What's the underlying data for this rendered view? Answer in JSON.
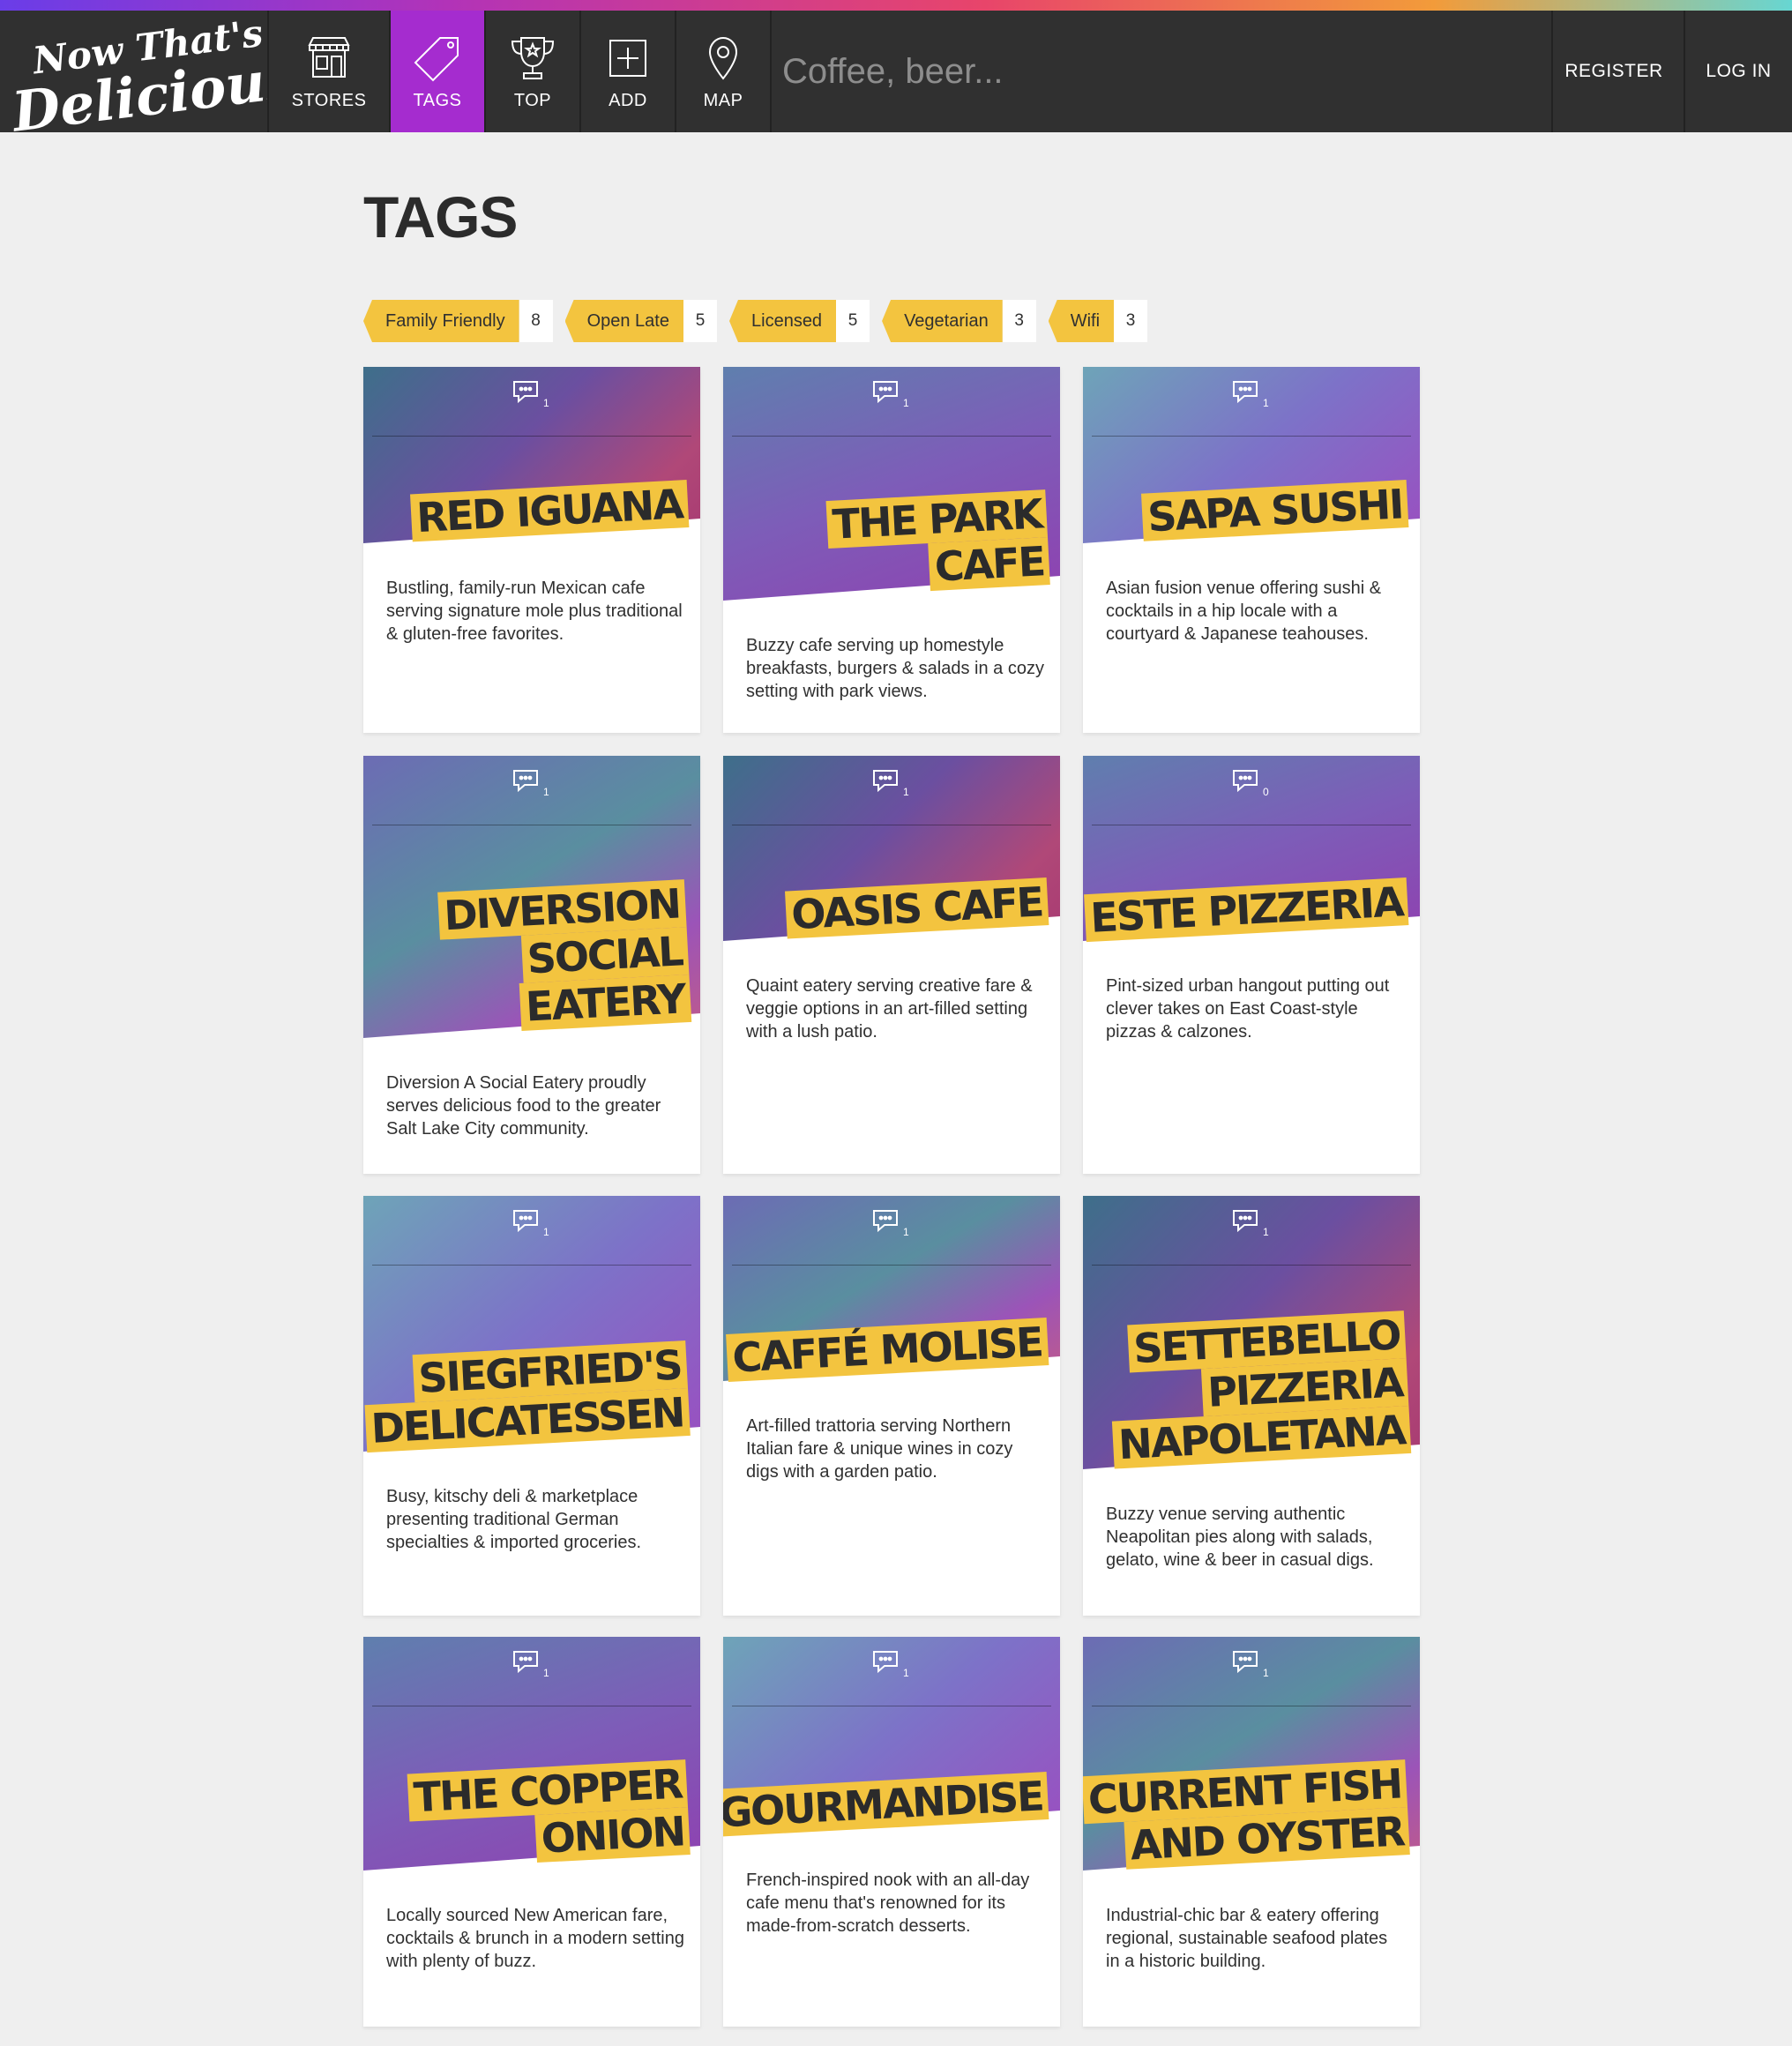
{
  "brand": {
    "logo_line1": "Now That's",
    "logo_line2": "Delicious!"
  },
  "nav": {
    "items": [
      {
        "label": "STORES",
        "icon": "store-icon"
      },
      {
        "label": "TAGS",
        "icon": "tag-icon",
        "active": true
      },
      {
        "label": "TOP",
        "icon": "trophy-icon"
      },
      {
        "label": "ADD",
        "icon": "add-icon"
      },
      {
        "label": "MAP",
        "icon": "map-pin-icon"
      }
    ],
    "search_placeholder": "Coffee, beer...",
    "register": "REGISTER",
    "login": "LOG IN"
  },
  "page": {
    "title": "TAGS"
  },
  "tags": [
    {
      "label": "Family Friendly",
      "count": "8"
    },
    {
      "label": "Open Late",
      "count": "5"
    },
    {
      "label": "Licensed",
      "count": "5"
    },
    {
      "label": "Vegetarian",
      "count": "3"
    },
    {
      "label": "Wifi",
      "count": "3"
    }
  ],
  "stores": [
    {
      "name_lines": [
        "RED IGUANA"
      ],
      "comments": "1",
      "description": "Bustling, family-run Mexican cafe serving signature mole plus traditional & gluten-free favorites."
    },
    {
      "name_lines": [
        "THE PARK",
        "CAFE"
      ],
      "comments": "1",
      "description": "Buzzy cafe serving up homestyle breakfasts, burgers & salads in a cozy setting with park views."
    },
    {
      "name_lines": [
        "SAPA SUSHI"
      ],
      "comments": "1",
      "description": "Asian fusion venue offering sushi & cocktails in a hip locale with a courtyard & Japanese teahouses."
    },
    {
      "name_lines": [
        "DIVERSION",
        "SOCIAL",
        "EATERY"
      ],
      "comments": "1",
      "description": "Diversion A Social Eatery proudly serves delicious food to the greater Salt Lake City community."
    },
    {
      "name_lines": [
        "OASIS CAFE"
      ],
      "comments": "1",
      "description": "Quaint eatery serving creative fare & veggie options in an art-filled setting with a lush patio."
    },
    {
      "name_lines": [
        "ESTE PIZZERIA"
      ],
      "comments": "0",
      "description": "Pint-sized urban hangout putting out clever takes on East Coast-style pizzas & calzones."
    },
    {
      "name_lines": [
        "SIEGFRIED'S",
        "DELICATESSEN"
      ],
      "comments": "1",
      "description": "Busy, kitschy deli & marketplace presenting traditional German specialties & imported groceries."
    },
    {
      "name_lines": [
        "CAFFÉ MOLISE"
      ],
      "comments": "1",
      "description": "Art-filled trattoria serving Northern Italian fare & unique wines in cozy digs with a garden patio."
    },
    {
      "name_lines": [
        "SETTEBELLO",
        "PIZZERIA",
        "NAPOLETANA"
      ],
      "comments": "1",
      "description": "Buzzy venue serving authentic Neapolitan pies along with salads, gelato, wine & beer in casual digs."
    },
    {
      "name_lines": [
        "THE COPPER",
        "ONION"
      ],
      "comments": "1",
      "description": "Locally sourced New American fare, cocktails & brunch in a modern setting with plenty of buzz."
    },
    {
      "name_lines": [
        "GOURMANDISE"
      ],
      "comments": "1",
      "description": "French-inspired nook with an all-day cafe menu that's renowned for its made-from-scratch desserts."
    },
    {
      "name_lines": [
        "CURRENT FISH",
        "AND OYSTER"
      ],
      "comments": "1",
      "description": "Industrial-chic bar & eatery offering regional, sustainable seafood plates in a historic building."
    }
  ]
}
